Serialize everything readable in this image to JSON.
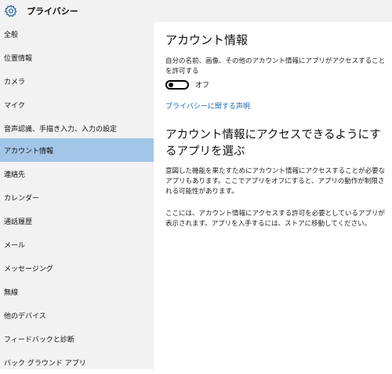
{
  "window": {
    "title": "プライバシー"
  },
  "sidebar": {
    "items": [
      {
        "label": "全般"
      },
      {
        "label": "位置情報"
      },
      {
        "label": "カメラ"
      },
      {
        "label": "マイク"
      },
      {
        "label": "音声認識、手描き入力、入力の設定"
      },
      {
        "label": "アカウント情報",
        "selected": true
      },
      {
        "label": "連絡先"
      },
      {
        "label": "カレンダー"
      },
      {
        "label": "通話履歴"
      },
      {
        "label": "メール"
      },
      {
        "label": "メッセージング"
      },
      {
        "label": "無線"
      },
      {
        "label": "他のデバイス"
      },
      {
        "label": "フィードバックと診断"
      },
      {
        "label": "バック グラウンド アプリ"
      }
    ]
  },
  "main": {
    "heading": "アカウント情報",
    "description": "自分の名前、画像、その他のアカウント情報にアプリがアクセスすることを許可する",
    "toggle": {
      "state": "off",
      "label": "オフ"
    },
    "privacy_link": "プライバシーに関する声明",
    "section_heading": "アカウント情報にアクセスできるようにするアプリを選ぶ",
    "paragraph1": "意図した機能を果たすためにアカウント情報にアクセスすることが必要なアプリもあります。ここでアプリをオフにすると、アプリの動作が制限される可能性があります。",
    "paragraph2": "ここには、アカウント情報にアクセスする許可を必要としているアプリが表示されます。アプリを入手するには、ストアに移動してください。"
  },
  "colors": {
    "sidebar_bg": "#f2f2f2",
    "selected_bg": "#a3c6e8",
    "link": "#1a66b3"
  },
  "icons": {
    "title": "gear-icon"
  }
}
